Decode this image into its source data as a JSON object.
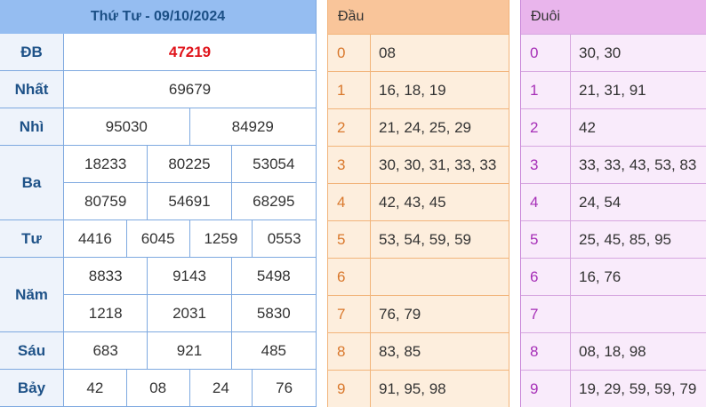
{
  "results": {
    "title": "Thứ Tư - 09/10/2024",
    "prizes": [
      {
        "label": "ĐB",
        "rows": [
          [
            "47219"
          ]
        ]
      },
      {
        "label": "Nhất",
        "rows": [
          [
            "69679"
          ]
        ]
      },
      {
        "label": "Nhì",
        "rows": [
          [
            "95030",
            "84929"
          ]
        ]
      },
      {
        "label": "Ba",
        "rows": [
          [
            "18233",
            "80225",
            "53054"
          ],
          [
            "80759",
            "54691",
            "68295"
          ]
        ]
      },
      {
        "label": "Tư",
        "rows": [
          [
            "4416",
            "6045",
            "1259",
            "0553"
          ]
        ]
      },
      {
        "label": "Năm",
        "rows": [
          [
            "8833",
            "9143",
            "5498"
          ],
          [
            "1218",
            "2031",
            "5830"
          ]
        ]
      },
      {
        "label": "Sáu",
        "rows": [
          [
            "683",
            "921",
            "485"
          ]
        ]
      },
      {
        "label": "Bảy",
        "rows": [
          [
            "42",
            "08",
            "24",
            "76"
          ]
        ]
      }
    ]
  },
  "dau": {
    "header": "Đầu",
    "rows": [
      {
        "num": "0",
        "vals": "08"
      },
      {
        "num": "1",
        "vals": "16, 18, 19"
      },
      {
        "num": "2",
        "vals": "21, 24, 25, 29"
      },
      {
        "num": "3",
        "vals": "30, 30, 31, 33, 33"
      },
      {
        "num": "4",
        "vals": "42, 43, 45"
      },
      {
        "num": "5",
        "vals": "53, 54, 59, 59"
      },
      {
        "num": "6",
        "vals": ""
      },
      {
        "num": "7",
        "vals": "76, 79"
      },
      {
        "num": "8",
        "vals": "83, 85"
      },
      {
        "num": "9",
        "vals": "91, 95, 98"
      }
    ]
  },
  "duoi": {
    "header": "Đuôi",
    "rows": [
      {
        "num": "0",
        "vals": "30, 30"
      },
      {
        "num": "1",
        "vals": "21, 31, 91"
      },
      {
        "num": "2",
        "vals": "42"
      },
      {
        "num": "3",
        "vals": "33, 33, 43, 53, 83"
      },
      {
        "num": "4",
        "vals": "24, 54"
      },
      {
        "num": "5",
        "vals": "25, 45, 85, 95"
      },
      {
        "num": "6",
        "vals": "16, 76"
      },
      {
        "num": "7",
        "vals": ""
      },
      {
        "num": "8",
        "vals": "08, 18, 98"
      },
      {
        "num": "9",
        "vals": "19, 29, 59, 59, 79"
      }
    ]
  }
}
